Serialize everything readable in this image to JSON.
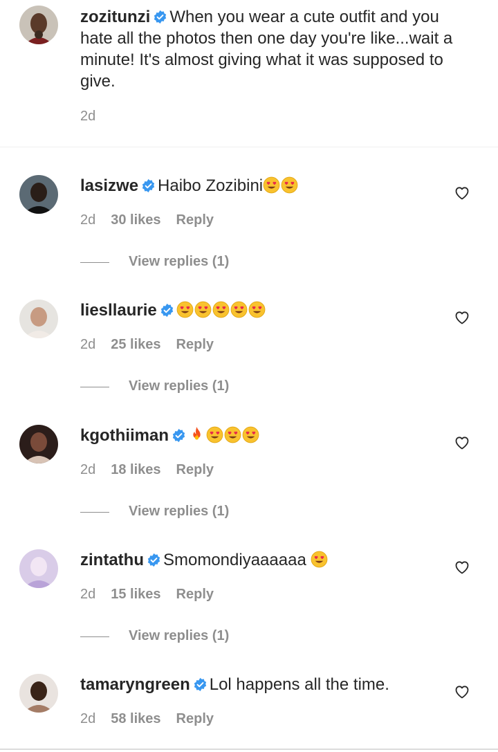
{
  "caption": {
    "username": "zozitunzi",
    "text": "When you wear a cute outfit and you hate all the photos then one day you're like...wait a minute! It's almost giving what it was supposed to give.",
    "time": "2d"
  },
  "comments": [
    {
      "username": "lasizwe",
      "text": "Haibo Zozibini",
      "emojis": [
        "heart-eyes",
        "heart-eyes"
      ],
      "time": "2d",
      "likes": "30 likes",
      "reply": "Reply",
      "view_replies": "View replies (1)"
    },
    {
      "username": "liesllaurie",
      "text": "",
      "emojis": [
        "heart-eyes",
        "heart-eyes",
        "heart-eyes",
        "heart-eyes",
        "heart-eyes"
      ],
      "time": "2d",
      "likes": "25 likes",
      "reply": "Reply",
      "view_replies": "View replies (1)"
    },
    {
      "username": "kgothiiman",
      "text": "",
      "emojis": [
        "fire",
        "heart-eyes",
        "heart-eyes",
        "heart-eyes"
      ],
      "time": "2d",
      "likes": "18 likes",
      "reply": "Reply",
      "view_replies": "View replies (1)"
    },
    {
      "username": "zintathu",
      "text": "Smomondiyaaaaaa ",
      "emojis": [
        "heart-eyes"
      ],
      "time": "2d",
      "likes": "15 likes",
      "reply": "Reply",
      "view_replies": "View replies (1)"
    },
    {
      "username": "tamaryngreen",
      "text": "Lol happens all the time.",
      "emojis": [],
      "time": "2d",
      "likes": "58 likes",
      "reply": "Reply",
      "view_replies": ""
    }
  ],
  "colors": {
    "verified": "#3897f0",
    "muted": "#8e8e8e",
    "text": "#262626"
  }
}
